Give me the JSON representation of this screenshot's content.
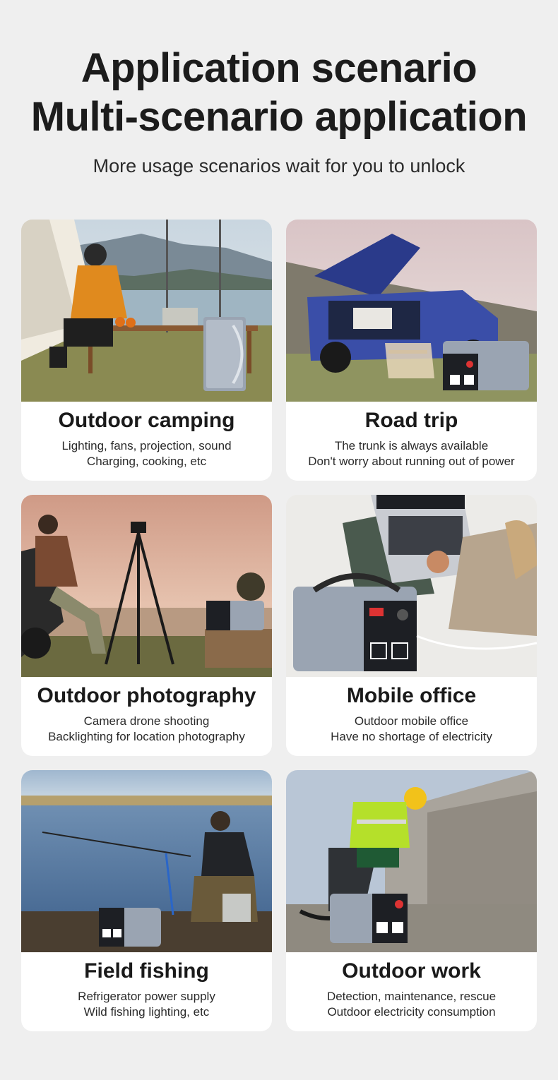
{
  "header": {
    "title_line1": "Application scenario",
    "title_line2": "Multi-scenario application",
    "subtitle": "More usage scenarios wait for you to unlock"
  },
  "scenarios": [
    {
      "title": "Outdoor camping",
      "line1": "Lighting, fans, projection, sound",
      "line2": "Charging, cooking, etc"
    },
    {
      "title": "Road trip",
      "line1": "The trunk is always available",
      "line2": "Don't worry about running out of power"
    },
    {
      "title": "Outdoor photography",
      "line1": "Camera drone shooting",
      "line2": "Backlighting for location photography"
    },
    {
      "title": "Mobile office",
      "line1": "Outdoor mobile office",
      "line2": "Have no shortage of electricity"
    },
    {
      "title": "Field fishing",
      "line1": "Refrigerator power supply",
      "line2": "Wild fishing lighting, etc"
    },
    {
      "title": "Outdoor work",
      "line1": "Detection, maintenance, rescue",
      "line2": "Outdoor electricity consumption"
    }
  ],
  "colors": {
    "page_background": "#efefef",
    "card_background": "#ffffff",
    "text": "#1a1a1a",
    "power_station": "#9aa4b2"
  }
}
